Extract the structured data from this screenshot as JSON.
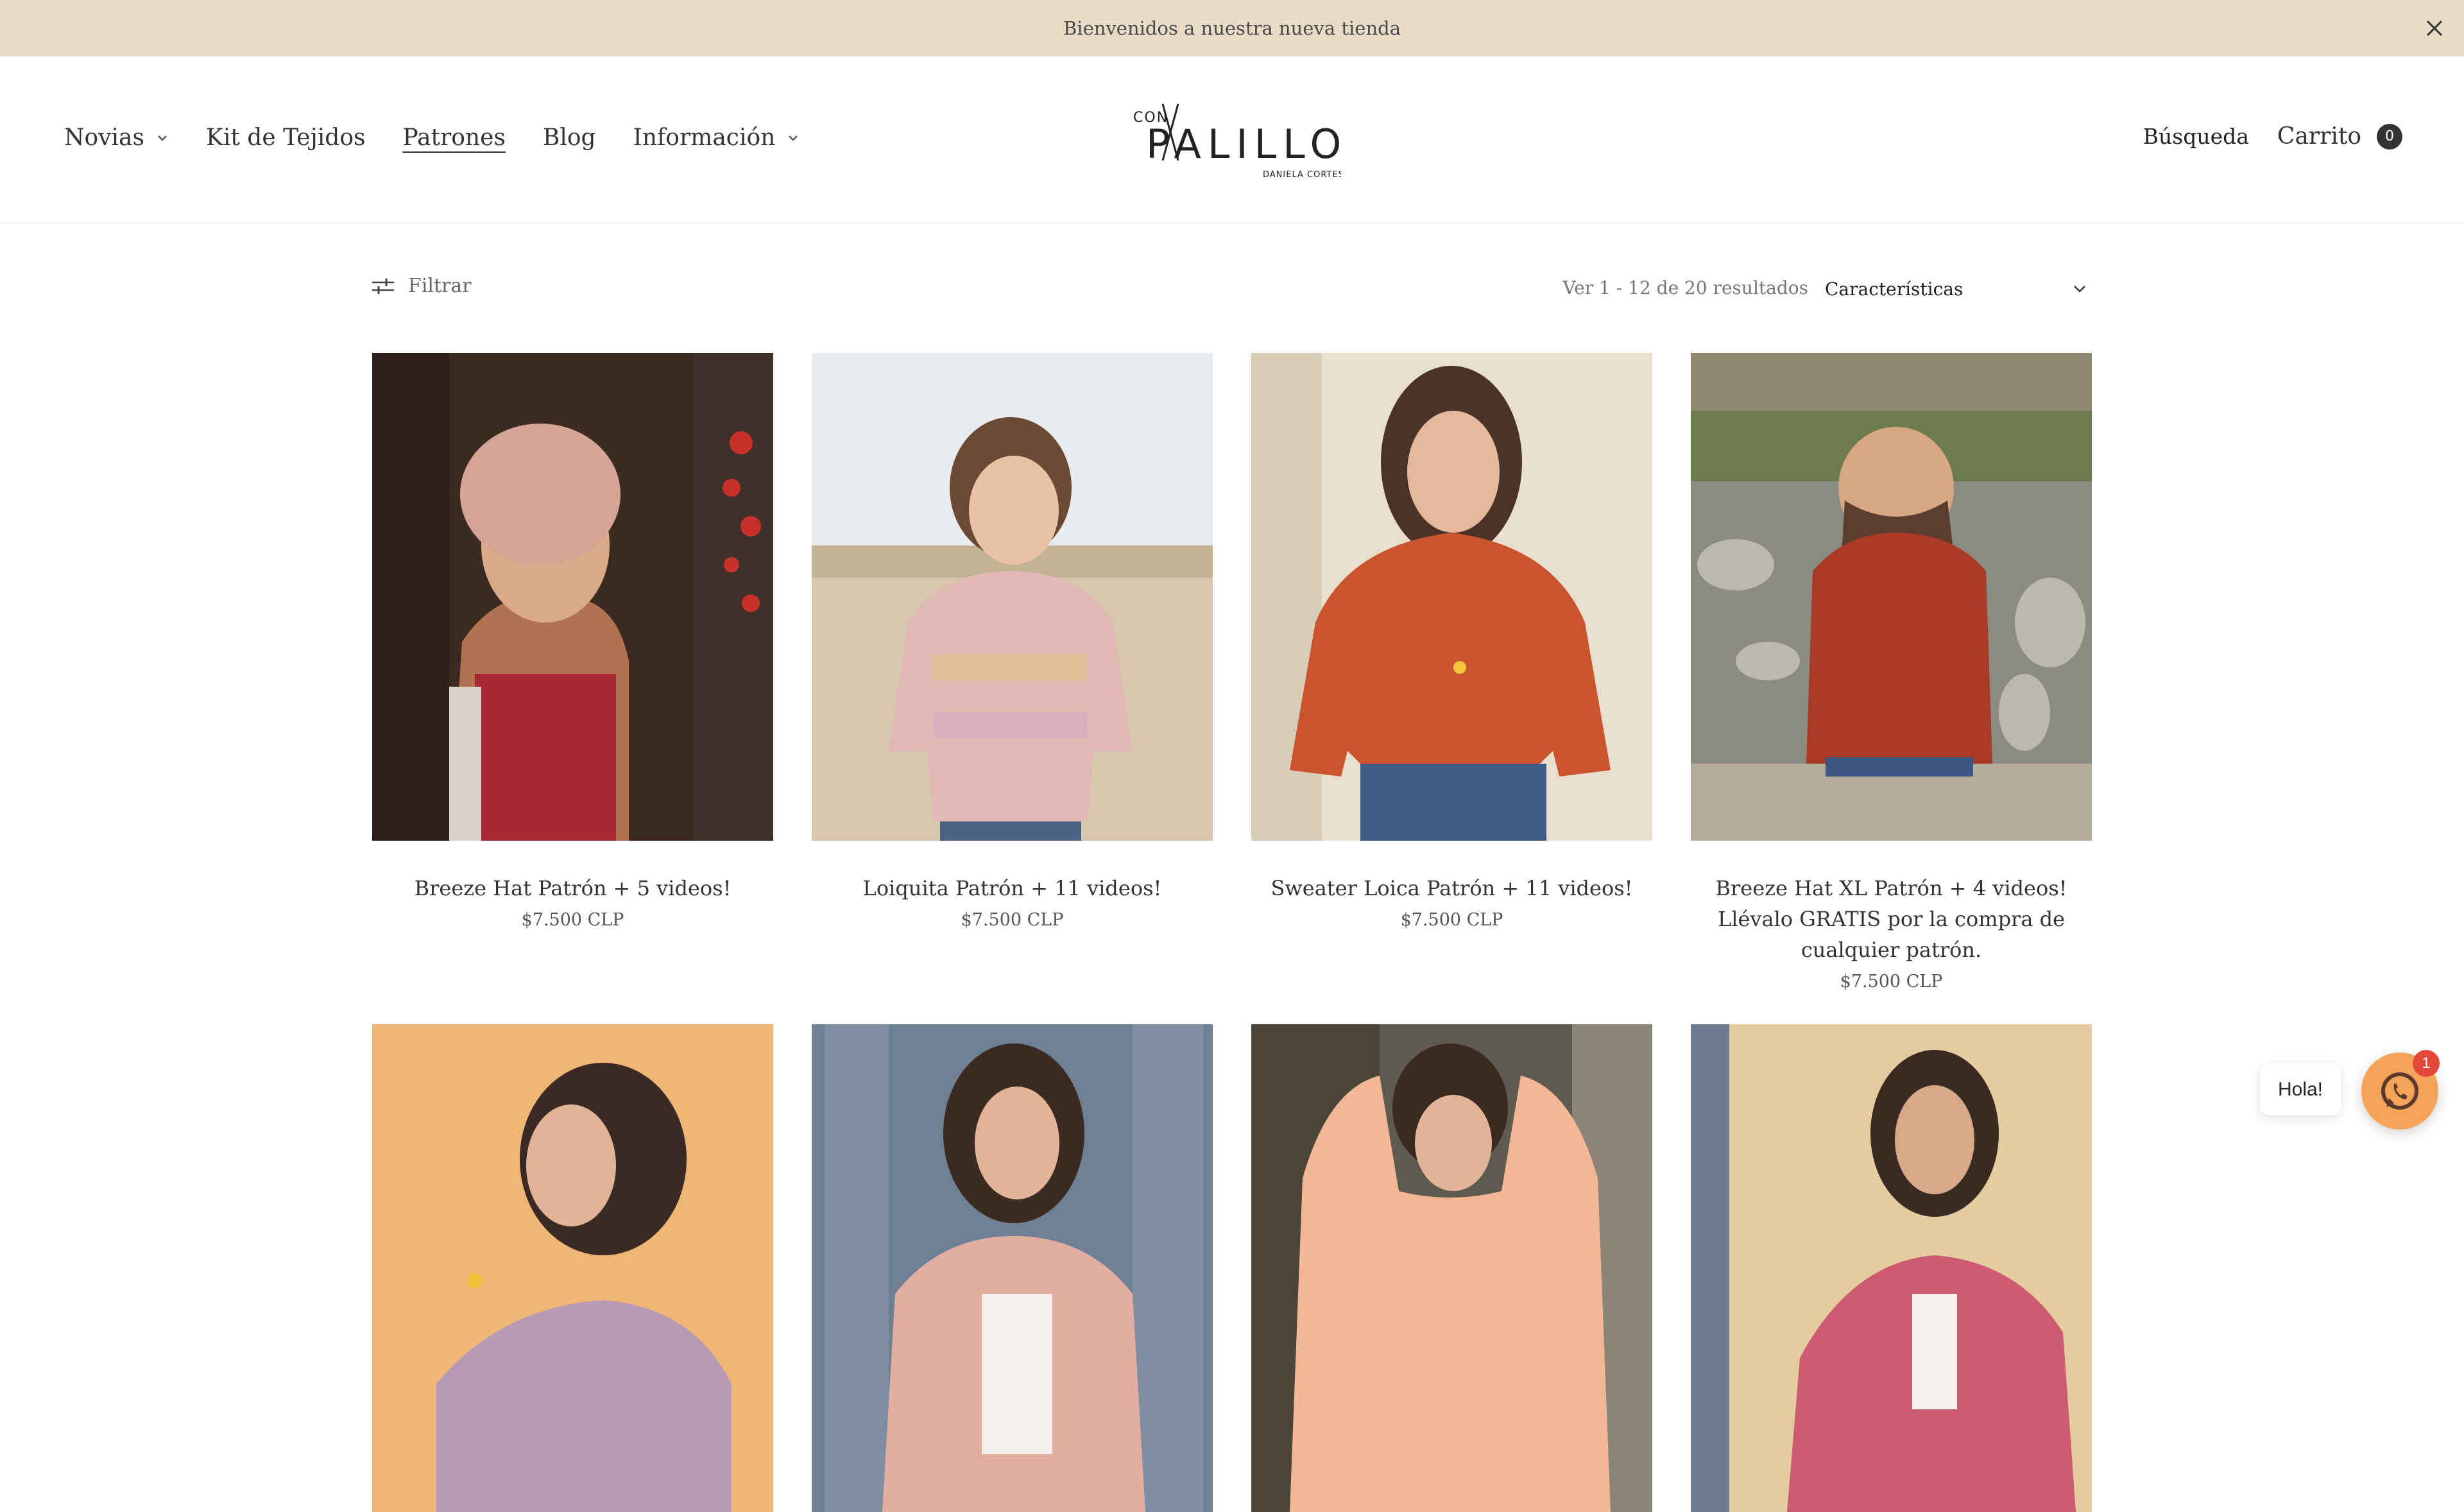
{
  "announcement": {
    "text": "Bienvenidos a nuestra nueva tienda"
  },
  "nav": {
    "items": [
      {
        "label": "Novias",
        "dropdown": true
      },
      {
        "label": "Kit de Tejidos",
        "dropdown": false
      },
      {
        "label": "Patrones",
        "dropdown": false,
        "active": true
      },
      {
        "label": "Blog",
        "dropdown": false
      },
      {
        "label": "Información",
        "dropdown": true
      }
    ]
  },
  "logo": {
    "small": "CON",
    "main": "PALILLOS",
    "sub": "DANIELA CORTES"
  },
  "header": {
    "search": "Búsqueda",
    "cart": "Carrito",
    "cart_count": "0"
  },
  "toolbar": {
    "filter": "Filtrar",
    "results": "Ver 1 - 12 de 20 resultados",
    "sort": "Características"
  },
  "products": [
    {
      "title": "Breeze Hat Patrón + 5 videos!",
      "price": "$7.500 CLP"
    },
    {
      "title": "Loiquita Patrón + 11 videos!",
      "price": "$7.500 CLP"
    },
    {
      "title": "Sweater Loica Patrón + 11 videos!",
      "price": "$7.500 CLP"
    },
    {
      "title": "Breeze Hat XL Patrón + 4 videos! Llévalo GRATIS por la compra de cualquier patrón.",
      "price": "$7.500 CLP"
    },
    {
      "title": "",
      "price": ""
    },
    {
      "title": "",
      "price": ""
    },
    {
      "title": "",
      "price": ""
    },
    {
      "title": "",
      "price": ""
    }
  ],
  "chat": {
    "greeting": "Hola!",
    "badge": "1"
  },
  "colors": {
    "announcement_bg": "#e9dcc7",
    "chat": "#f6a35a",
    "badge": "#e5483b"
  }
}
